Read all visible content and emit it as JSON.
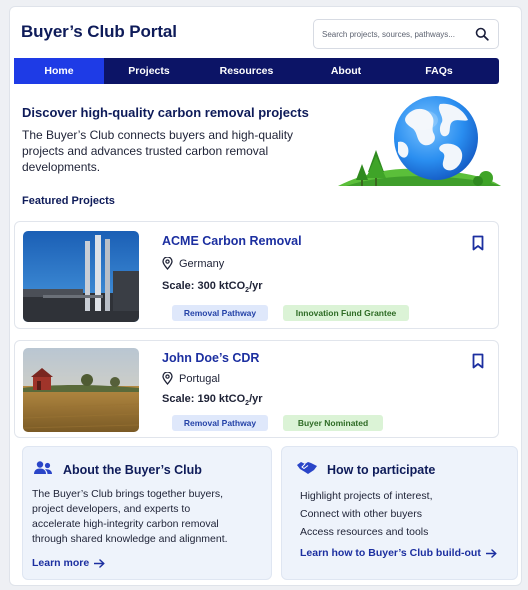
{
  "app": {
    "title": "Buyer’s Club Portal"
  },
  "search": {
    "placeholder": "Search projects, sources, pathways..."
  },
  "nav": {
    "items": [
      {
        "label": "Home",
        "active": true
      },
      {
        "label": "Projects"
      },
      {
        "label": "Resources"
      },
      {
        "label": "About"
      },
      {
        "label": "FAQs"
      }
    ]
  },
  "hero": {
    "title": "Discover high-quality carbon removal projects",
    "body": "The Buyer’s Club connects buyers and high-quality projects and advances trusted carbon removal developments."
  },
  "featured": {
    "title": "Featured Projects",
    "projects": [
      {
        "name": "ACME Carbon Removal",
        "location": "Germany",
        "scale_prefix": "Scale: 300 ktCO",
        "scale_sub": "2",
        "scale_suffix": "/yr",
        "tags": [
          "Removal Pathway",
          "Innovation Fund Grantee"
        ]
      },
      {
        "name": "John Doe’s CDR",
        "location": "Portugal",
        "scale_prefix": "Scale: 190 ktCO",
        "scale_sub": "2",
        "scale_suffix": "/yr",
        "tags": [
          "Removal Pathway",
          "Buyer Nominated"
        ]
      }
    ]
  },
  "about": {
    "title": "About the Buyer’s Club",
    "lines": [
      "The Buyer’s Club brings together buyers,",
      "project developers, and experts to",
      "accelerate high-integrity carbon removal",
      "through shared knowledge and alignment."
    ],
    "link": "Learn more"
  },
  "participate": {
    "title": "How to participate",
    "lines": [
      "Highlight projects of interest,",
      "Connect with other buyers",
      "Access resources and tools"
    ],
    "link": "Learn how to Buyer’s Club build-out"
  },
  "colors": {
    "nav_bg": "#0c1466",
    "nav_active": "#1e3be6",
    "title": "#0e1b59",
    "link": "#1c2fa0",
    "tag_blue_bg": "#dfe8fb",
    "tag_green_bg": "#dbf3d6"
  }
}
